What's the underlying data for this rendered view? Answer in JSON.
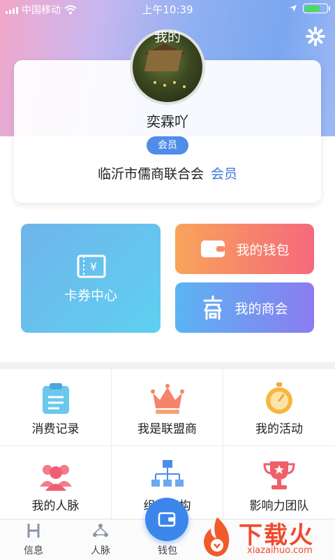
{
  "status_bar": {
    "carrier": "中国移动",
    "time": "上午10:39"
  },
  "header": {
    "title": "我的"
  },
  "profile": {
    "username": "奕霖吖",
    "badge": "会员",
    "organization": "临沂市儒商联合会",
    "role": "会员"
  },
  "tiles": {
    "coupon": "卡券中心",
    "wallet": "我的钱包",
    "chamber": "我的商会"
  },
  "grid": [
    {
      "label": "消费记录",
      "icon": "clipboard-icon"
    },
    {
      "label": "我是联盟商",
      "icon": "crown-icon"
    },
    {
      "label": "我的活动",
      "icon": "stopwatch-icon"
    },
    {
      "label": "我的人脉",
      "icon": "people-icon"
    },
    {
      "label": "组织架构",
      "icon": "org-chart-icon"
    },
    {
      "label": "影响力团队",
      "icon": "trophy-icon"
    }
  ],
  "tab_bar": {
    "tabs": [
      "信息",
      "人脉",
      "钱包"
    ]
  },
  "watermark": {
    "text": "下载火",
    "url": "xiazaihuo.com"
  },
  "colors": {
    "accent": "#3c86ea",
    "badge": "#4f8de9",
    "role_text": "#3c78d8"
  }
}
